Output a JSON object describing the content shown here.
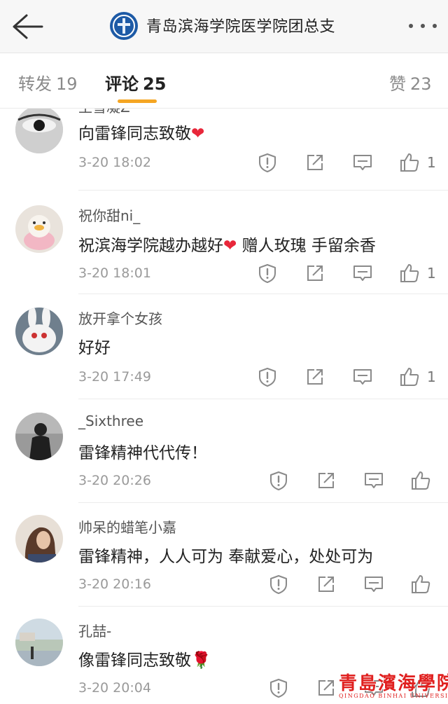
{
  "header": {
    "account_name": "青岛滨海学院医学院团总支",
    "icons": {
      "back": "back-arrow-icon",
      "more": "more-dots-icon",
      "logo": "account-logo"
    }
  },
  "tabs": [
    {
      "label": "转发",
      "count": "19",
      "active": false
    },
    {
      "label": "评论",
      "count": "25",
      "active": true
    },
    {
      "label": "赞",
      "count": "23",
      "active": false
    }
  ],
  "colors": {
    "accent": "#f5a623",
    "heart": "#e8273a",
    "watermark": "#e0201f"
  },
  "comments": [
    {
      "user": "王雪凝Z",
      "text": "向雷锋同志致敬",
      "emoji": "❤",
      "time": "3-20 18:02",
      "likes": "1"
    },
    {
      "user": "祝你甜ni_",
      "text": "祝滨海学院越办越好",
      "emoji": "❤",
      "text_after": " 赠人玫瑰 手留余香",
      "time": "3-20 18:01",
      "likes": "1"
    },
    {
      "user": "放开拿个女孩",
      "text": "好好",
      "time": "3-20 17:49",
      "likes": "1"
    },
    {
      "user": "_Sixthree",
      "text": "雷锋精神代代传！",
      "time": "3-20 20:26",
      "likes": ""
    },
    {
      "user": "帅呆的蜡笔小嘉",
      "text": "雷锋精神，人人可为 奉献爱心，处处可为",
      "time": "3-20 20:16",
      "likes": ""
    },
    {
      "user": "孔喆-",
      "text": "像雷锋同志致敬",
      "emoji": "🌹",
      "time": "3-20 20:04",
      "likes": ""
    }
  ],
  "action_icons": [
    "report-icon",
    "share-icon",
    "reply-icon",
    "like-icon"
  ],
  "watermark": {
    "cn": "青島濱海學院",
    "en": "QINGDAO BINHAI UNIVERSITY"
  }
}
